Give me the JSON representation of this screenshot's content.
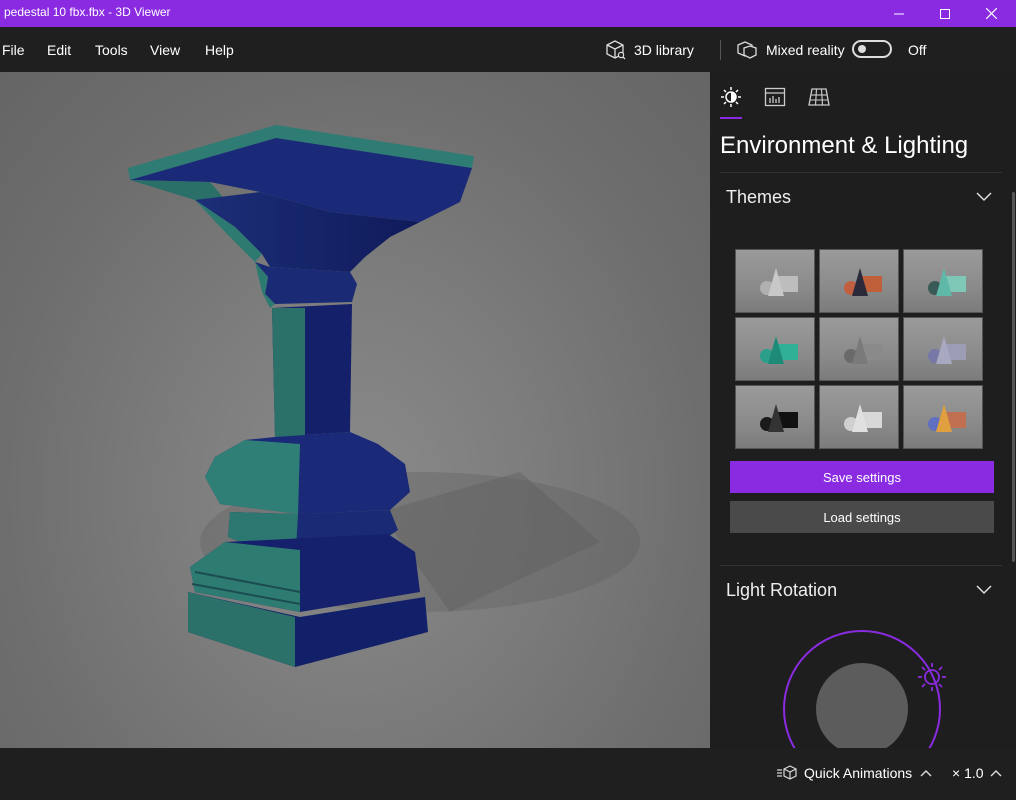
{
  "window": {
    "title": "pedestal 10 fbx.fbx - 3D Viewer"
  },
  "menu": {
    "file": "File",
    "edit": "Edit",
    "tools": "Tools",
    "view": "View",
    "help": "Help"
  },
  "toolbar": {
    "library_label": "3D library",
    "mixed_reality_label": "Mixed reality",
    "mixed_reality_state": "Off"
  },
  "panel": {
    "title": "Environment & Lighting",
    "tabs": [
      "sun-icon",
      "stats-icon",
      "grid-icon"
    ],
    "themes": {
      "label": "Themes",
      "tiles": [
        {
          "name": "theme-1",
          "sphere": "#b0b0b0",
          "cone": "#c8c8c8",
          "cube": "#bdbdbd"
        },
        {
          "name": "theme-2",
          "sphere": "#c06040",
          "cone": "#2a2a3a",
          "cube": "#c0603a"
        },
        {
          "name": "theme-3",
          "sphere": "#3a5a58",
          "cone": "#5fb8a8",
          "cube": "#7fc8b8"
        },
        {
          "name": "theme-4",
          "sphere": "#2aa08a",
          "cone": "#1e8a78",
          "cube": "#30b096"
        },
        {
          "name": "theme-5",
          "sphere": "#6a6a6a",
          "cone": "#7a7a7a",
          "cube": "#8a8a8a"
        },
        {
          "name": "theme-6",
          "sphere": "#7878a8",
          "cone": "#a8a8c0",
          "cube": "#9c9cb4"
        },
        {
          "name": "theme-7",
          "sphere": "#1a1a1a",
          "cone": "#333333",
          "cube": "#111111"
        },
        {
          "name": "theme-8",
          "sphere": "#d0d0d0",
          "cone": "#e0e0e0",
          "cube": "#d8d8d8"
        },
        {
          "name": "theme-9",
          "sphere": "#6070c0",
          "cone": "#e0a040",
          "cube": "#c07050"
        }
      ]
    },
    "save_label": "Save settings",
    "load_label": "Load settings",
    "light_rotation": {
      "label": "Light Rotation"
    }
  },
  "bottom": {
    "quick_animations": "Quick Animations",
    "speed": "× 1.0"
  },
  "colors": {
    "accent": "#8a2be2",
    "panel_bg": "#1e1e1e",
    "viewport_bg": "#7a7a7a"
  }
}
